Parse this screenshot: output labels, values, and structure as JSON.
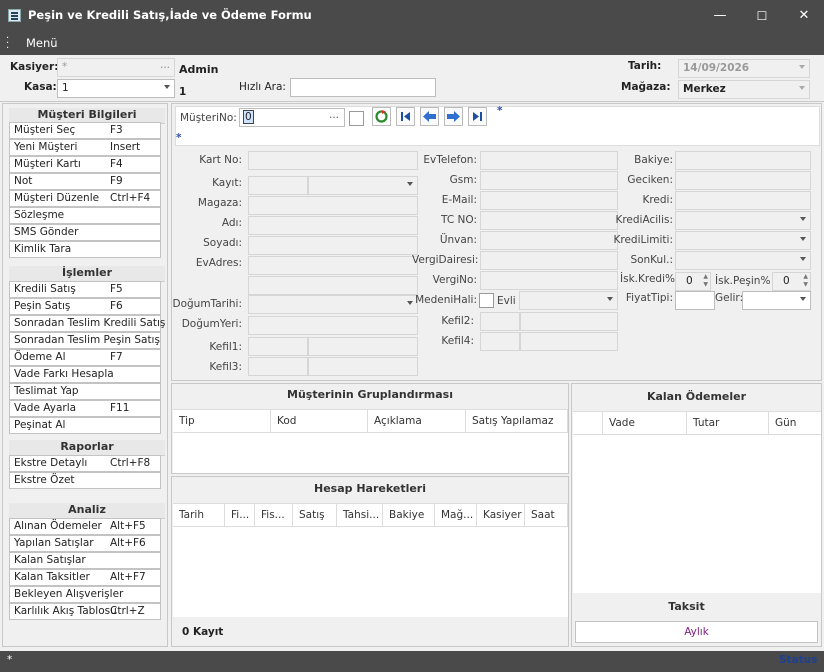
{
  "window": {
    "title": "Peşin ve Kredili Satış,İade ve Ödeme Formu",
    "minimize": "—",
    "maximize": "☐",
    "close": "✕"
  },
  "menubar": {
    "menu_label": "Menü"
  },
  "topbar": {
    "kasiyer_label": "Kasiyer:",
    "kasiyer_value": "*",
    "kasiyer_user": "Admin",
    "kasa_label": "Kasa:",
    "kasa_value": "1",
    "kasa_number": "1",
    "hizli_ara_label": "Hızlı Ara:",
    "hizli_ara_value": "",
    "tarih_label": "Tarih:",
    "tarih_value": "14/09/2026",
    "magaza_label": "Mağaza:",
    "magaza_value": "Merkez"
  },
  "sidebar": {
    "musteri_title": "Müşteri Bilgileri",
    "musteri_items": [
      {
        "label": "Müşteri Seç",
        "shortcut": "F3"
      },
      {
        "label": "Yeni Müşteri",
        "shortcut": "Insert"
      },
      {
        "label": "Müşteri Kartı",
        "shortcut": "F4"
      },
      {
        "label": "Not",
        "shortcut": "F9"
      },
      {
        "label": "Müşteri Düzenle",
        "shortcut": "Ctrl+F4"
      },
      {
        "label": "Sözleşme",
        "shortcut": ""
      },
      {
        "label": "SMS Gönder",
        "shortcut": ""
      },
      {
        "label": "Kimlik Tara",
        "shortcut": ""
      }
    ],
    "islemler_title": "İşlemler",
    "islemler_items": [
      {
        "label": "Kredili Satış",
        "shortcut": "F5"
      },
      {
        "label": "Peşin Satış",
        "shortcut": "F6"
      },
      {
        "label": "Sonradan Teslim Kredili Satış",
        "shortcut": ""
      },
      {
        "label": "Sonradan Teslim Peşin  Satış",
        "shortcut": ""
      },
      {
        "label": "Ödeme Al",
        "shortcut": "F7"
      },
      {
        "label": "Vade Farkı Hesapla",
        "shortcut": ""
      },
      {
        "label": "Teslimat Yap",
        "shortcut": ""
      },
      {
        "label": "Vade Ayarla",
        "shortcut": "F11"
      },
      {
        "label": "Peşinat Al",
        "shortcut": ""
      }
    ],
    "raporlar_title": "Raporlar",
    "raporlar_items": [
      {
        "label": "Ekstre Detaylı",
        "shortcut": "Ctrl+F8"
      },
      {
        "label": "Ekstre Özet",
        "shortcut": ""
      }
    ],
    "analiz_title": "Analiz",
    "analiz_items": [
      {
        "label": "Alınan Ödemeler",
        "shortcut": "Alt+F5"
      },
      {
        "label": "Yapılan Satışlar",
        "shortcut": "Alt+F6"
      },
      {
        "label": "Kalan Satışlar",
        "shortcut": ""
      },
      {
        "label": "Kalan Taksitler",
        "shortcut": "Alt+F7"
      },
      {
        "label": "Bekleyen Alışverişler",
        "shortcut": ""
      },
      {
        "label": "Karlılık Akış Tablosu",
        "shortcut": "Ctrl+Z"
      }
    ]
  },
  "customer": {
    "musteri_no_label": "MüşteriNo:",
    "musteri_no_value": "0",
    "star1": "*",
    "star2": "*",
    "col1": {
      "kart_no": "Kart No:",
      "kayit": "Kayıt:",
      "magaza": "Magaza:",
      "adi": "Adı:",
      "soyadi": "Soyadı:",
      "ev_adres": "EvAdres:",
      "dogum_tarihi": "DoğumTarihi:",
      "dogum_yeri": "DoğumYeri:",
      "kefil1": "Kefil1:",
      "kefil3": "Kefil3:"
    },
    "col2": {
      "ev_telefon": "EvTelefon:",
      "gsm": "Gsm:",
      "email": "E-Mail:",
      "tc_no": "TC NO:",
      "unvan": "Ünvan:",
      "vergi_dairesi": "VergiDairesi:",
      "vergi_no": "VergiNo:",
      "medeni_hali": "MedeniHali:",
      "evli": "Evli",
      "kefil2": "Kefil2:",
      "kefil4": "Kefil4:"
    },
    "col3": {
      "bakiye": "Bakiye:",
      "geciken": "Geciken:",
      "kredi": "Kredi:",
      "kredi_acilis": "KrediAcilis:",
      "kredi_limiti": "KrediLimiti:",
      "son_kul": "SonKul.:",
      "isk_kredi": "İsk.Kredi%",
      "isk_kredi_value": "0",
      "isk_pesin": "İsk.Peşin%",
      "isk_pesin_value": "0",
      "fiyat_tipi": "FiyatTipi:",
      "gelir": "Gelir:"
    }
  },
  "gruplandirma": {
    "title": "Müşterinin Gruplandırması",
    "columns": [
      "Tip",
      "Kod",
      "Açıklama",
      "Satış Yapılamaz"
    ]
  },
  "hareketler": {
    "title": "Hesap Hareketleri",
    "columns": [
      "Tarih",
      "Fi...",
      "Fis...",
      "Satış",
      "Tahsi...",
      "Bakiye",
      "Mağ...",
      "Kasiyer",
      "Saat"
    ],
    "kayit": "0 Kayıt"
  },
  "kalan": {
    "title": "Kalan Ödemeler",
    "columns": [
      "",
      "Vade",
      "Tutar",
      "Gün"
    ],
    "taksit": "Taksit",
    "aylik": "Aylık"
  },
  "status": {
    "left": "*",
    "right": "Status"
  },
  "colors": {
    "titlebar": "#4a4a4a",
    "statusbar_text": "#1f3f8f",
    "aylik_text": "#7a1f7a"
  }
}
